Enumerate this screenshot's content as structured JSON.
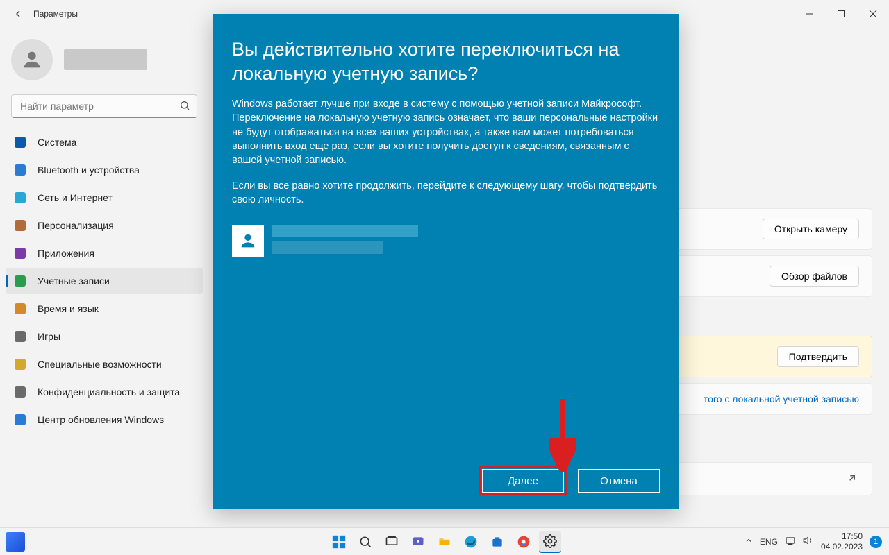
{
  "titlebar": {
    "title": "Параметры"
  },
  "search": {
    "placeholder": "Найти параметр"
  },
  "nav": {
    "items": [
      {
        "label": "Система",
        "icon": "#0a5aa8"
      },
      {
        "label": "Bluetooth и устройства",
        "icon": "#2a7bd4"
      },
      {
        "label": "Сеть и Интернет",
        "icon": "#2aa7d4"
      },
      {
        "label": "Персонализация",
        "icon": "#b46b3a"
      },
      {
        "label": "Приложения",
        "icon": "#7a3aa8"
      },
      {
        "label": "Учетные записи",
        "icon": "#2a9c4e"
      },
      {
        "label": "Время и язык",
        "icon": "#d48a2a"
      },
      {
        "label": "Игры",
        "icon": "#6b6b6b"
      },
      {
        "label": "Специальные возможности",
        "icon": "#d4a82a"
      },
      {
        "label": "Конфиденциальность и защита",
        "icon": "#6b6b6b"
      },
      {
        "label": "Центр обновления Windows",
        "icon": "#2a7bd4"
      }
    ],
    "active_index": 5
  },
  "content": {
    "open_camera_btn": "Открыть камеру",
    "browse_files_btn": "Обзор файлов",
    "confirm_btn": "Подтвердить",
    "local_account_link": "того с локальной учетной записью"
  },
  "dialog": {
    "heading": "Вы действительно хотите переключиться на локальную учетную запись?",
    "para1": "Windows работает лучше при входе в систему с помощью учетной записи Майкрософт. Переключение на локальную учетную запись означает, что ваши персональные настройки не будут отображаться на всех ваших устройствах, а также вам может потребоваться выполнить вход еще раз, если вы хотите получить доступ к сведениям, связанным с вашей учетной записью.",
    "para2": "Если вы все равно хотите продолжить, перейдите к следующему шагу, чтобы подтвердить свою личность.",
    "next_btn": "Далее",
    "cancel_btn": "Отмена"
  },
  "tray": {
    "lang": "ENG",
    "time": "17:50",
    "date": "04.02.2023",
    "notif_count": "1"
  }
}
